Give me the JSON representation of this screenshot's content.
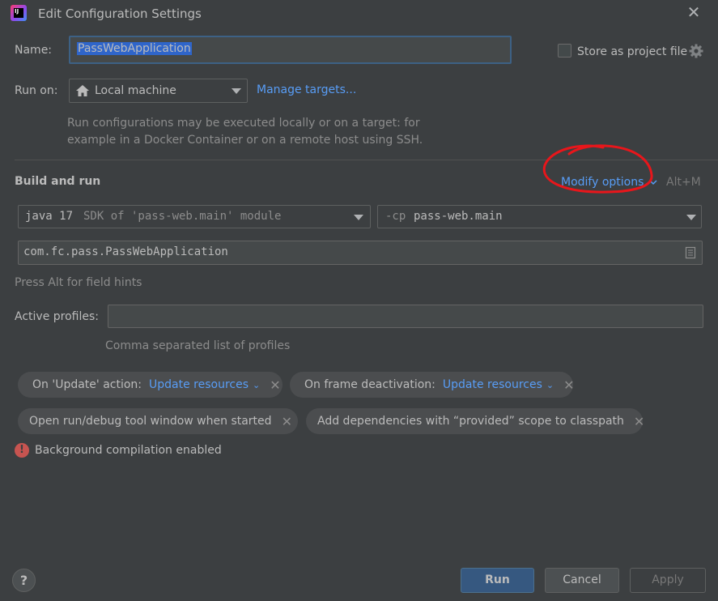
{
  "window": {
    "title": "Edit Configuration Settings",
    "close_glyph": "✕",
    "app_icon_text": "IJ"
  },
  "name_row": {
    "label": "Name:",
    "value": "PassWebApplication",
    "store_label": "Store as project file",
    "store_checked": false
  },
  "run_on": {
    "label": "Run on:",
    "value": "Local machine",
    "manage_link": "Manage targets...",
    "hint_line1": "Run configurations may be executed locally or on a target: for",
    "hint_line2": "example in a Docker Container or on a remote host using SSH."
  },
  "build_run": {
    "title": "Build and run",
    "modify_link": "Modify options",
    "modify_shortcut": "Alt+M",
    "sdk_name": "java 17",
    "sdk_detail": "SDK of 'pass-web.main' module",
    "cp_flag": "-cp",
    "cp_value": "pass-web.main",
    "main_class": "com.fc.pass.PassWebApplication",
    "alt_hint": "Press Alt for field hints"
  },
  "profiles": {
    "label": "Active profiles:",
    "value": "",
    "hint": "Comma separated list of profiles"
  },
  "chips": [
    {
      "label": "On 'Update' action:",
      "link": "Update resources",
      "close": "✕"
    },
    {
      "label": "On frame deactivation:",
      "link": "Update resources",
      "close": "✕"
    },
    {
      "label": "Open run/debug tool window when started",
      "close": "✕"
    },
    {
      "label": "Add dependencies with “provided” scope to classpath",
      "close": "✕"
    }
  ],
  "status": {
    "icon": "!",
    "text": "Background compilation enabled"
  },
  "footer": {
    "help": "?",
    "run": "Run",
    "cancel": "Cancel",
    "apply": "Apply"
  },
  "colors": {
    "background": "#3c3f41",
    "link": "#589df6",
    "selection": "#2f65ca",
    "primary_button": "#365880",
    "error": "#c75450",
    "annotation": "#e8161b"
  }
}
